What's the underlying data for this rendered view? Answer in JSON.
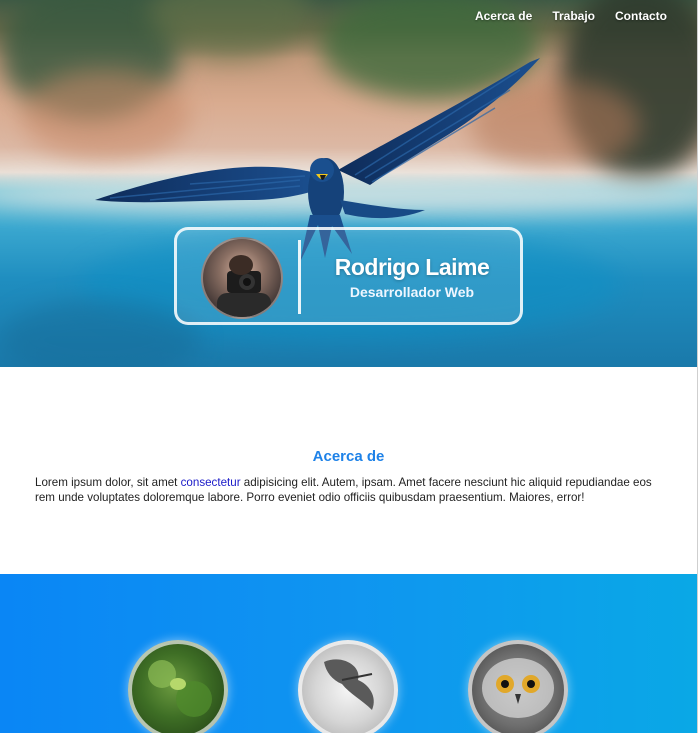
{
  "nav": {
    "items": [
      "Acerca de",
      "Trabajo",
      "Contacto"
    ]
  },
  "profile": {
    "name": "Rodrigo Laime",
    "role": "Desarrollador Web"
  },
  "about": {
    "title": "Acerca de",
    "text_before": "Lorem ipsum dolor, sit amet ",
    "highlight": "consectetur",
    "text_after": " adipisicing elit. Autem, ipsam. Amet facere nesciunt hic aliquid repudiandae eos rem unde voluptates doloremque labore. Porro eveniet odio officiis quibusdam praesentium. Maiores, error!"
  },
  "icons": {
    "bird": "flying-macaw",
    "avatar": "person-with-camera",
    "work": [
      "green-parrot",
      "flying-bird-grayscale",
      "owl-face"
    ]
  },
  "colors": {
    "accent": "#1e82e8",
    "link": "#1a1ac8",
    "work_bg_start": "#0a86f5",
    "work_bg_end": "#0aa8e6"
  }
}
